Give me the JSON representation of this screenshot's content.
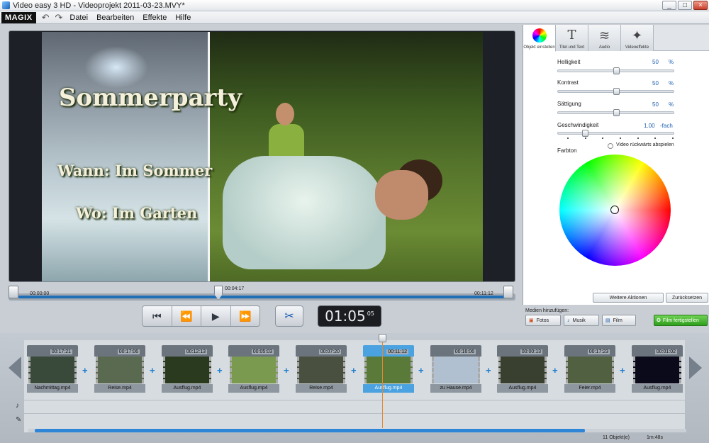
{
  "window": {
    "title": "Video easy 3 HD - Videoprojekt 2011-03-23.MVY*",
    "min": "_",
    "max": "□",
    "close": "×"
  },
  "menubar": {
    "logo": "MAGIX",
    "undo": "↶",
    "redo": "↷",
    "items": [
      "Datei",
      "Bearbeiten",
      "Effekte",
      "Hilfe"
    ]
  },
  "preview": {
    "title_line1": "Sommerparty",
    "title_line2": "Wann: Im Sommer",
    "title_line3": "Wo:  Im Garten"
  },
  "scrubber": {
    "start": "00:00:00",
    "current": "00:04:17",
    "end": "00:11:12"
  },
  "transport": {
    "prev": "⏮",
    "rewind": "⏪",
    "play": "▶",
    "forward": "⏩",
    "cut": "✂"
  },
  "timecode": {
    "main": "01:05",
    "frames": "05"
  },
  "tabs": [
    {
      "label": "Objekt einstellen",
      "icon": "color-wheel-icon"
    },
    {
      "label": "Titel und Text",
      "icon": "T"
    },
    {
      "label": "Audio",
      "icon": "≋"
    },
    {
      "label": "Videoeffekte",
      "icon": "✦"
    }
  ],
  "sliders": {
    "helligkeit": {
      "label": "Helligkeit",
      "value": "50",
      "unit": "%",
      "level": 0.5
    },
    "kontrast": {
      "label": "Kontrast",
      "value": "50",
      "unit": "%",
      "level": 0.5
    },
    "saettigung": {
      "label": "Sättigung",
      "value": "50",
      "unit": "%",
      "level": 0.5
    },
    "geschwindigkeit": {
      "label": "Geschwindigkeit",
      "value": "1.00",
      "unit": "-fach",
      "level": 0.22
    }
  },
  "reverse_label": "Video rückwärts abspielen",
  "farbton_label": "Farbton",
  "actions": {
    "more": "Weitere Aktionen",
    "reset": "Zurücksetzen"
  },
  "media": {
    "label": "Medien hinzufügen:",
    "fotos": "Fotos",
    "musik": "Musik",
    "film": "Film",
    "finish": "Film fertigstellen"
  },
  "clips": [
    {
      "name": "Nachmittag.mp4",
      "duration": "00:17:21",
      "color": "#3a4a3a"
    },
    {
      "name": "Reise.mp4",
      "duration": "00:17:06",
      "color": "#5a6a50"
    },
    {
      "name": "Ausflug.mp4",
      "duration": "00:12:13",
      "color": "#2a3a1e"
    },
    {
      "name": "Ausflug.mp4",
      "duration": "00:05:03",
      "color": "#7a9a50"
    },
    {
      "name": "Reise.mp4",
      "duration": "00:07:20",
      "color": "#4a5040"
    },
    {
      "name": "Ausflug.mp4",
      "duration": "00:11:12",
      "color": "#5a7a3a"
    },
    {
      "name": "zu Hause.mp4",
      "duration": "00:16:06",
      "color": "#b0c0d0"
    },
    {
      "name": "Ausflug.mp4",
      "duration": "00:00:13",
      "color": "#3a4030"
    },
    {
      "name": "Feier.mp4",
      "duration": "00:17:23",
      "color": "#506040"
    },
    {
      "name": "Ausflug.mp4",
      "duration": "00:01:02",
      "color": "#0a0a1a"
    }
  ],
  "status": {
    "objects": "11 Objekt(e)",
    "length": "1m:48s"
  },
  "accent": "#1f7fd0"
}
